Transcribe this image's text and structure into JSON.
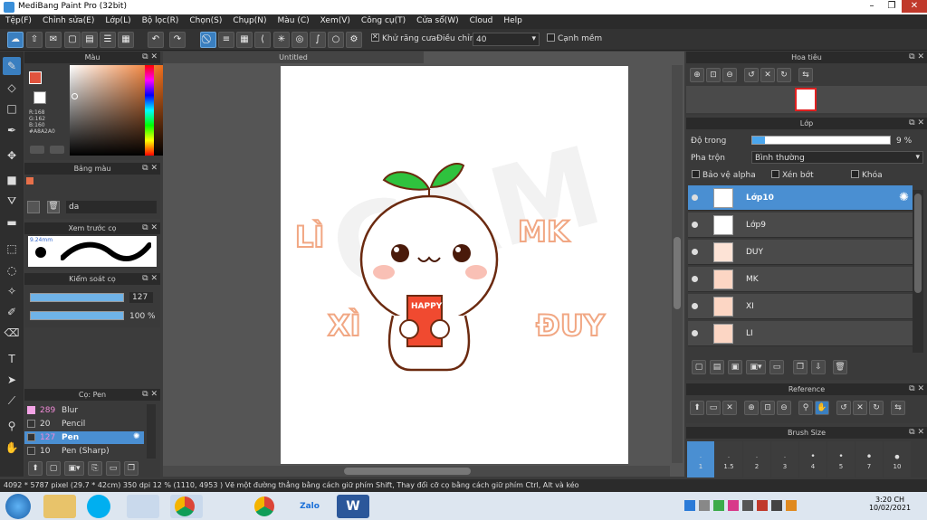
{
  "window": {
    "title": "MediBang Paint Pro (32bit)"
  },
  "menu": [
    "Tệp(F)",
    "Chỉnh sửa(E)",
    "Lớp(L)",
    "Bộ lọc(R)",
    "Chọn(S)",
    "Chụp(N)",
    "Màu (C)",
    "Xem(V)",
    "Công cụ(T)",
    "Cửa sổ(W)",
    "Cloud",
    "Help"
  ],
  "toolbar": {
    "antialias_label": "Khử răng cưa",
    "adjust_label": "Điều chỉnh",
    "adjust_value": "40",
    "smooth_label": "Cạnh mềm"
  },
  "color_panel": {
    "title": "Màu",
    "r": "R:168",
    "g": "G:162",
    "b": "B:160",
    "hex": "#A8A2A0",
    "accent": "#e0533d"
  },
  "palette_panel": {
    "title": "Bảng màu",
    "entry": "da"
  },
  "brush_preview": {
    "title": "Xem trước cọ",
    "size": "9.24mm"
  },
  "control_panel": {
    "title": "Kiểm soát cọ",
    "size": "127",
    "opacity": "100 %"
  },
  "brush_panel": {
    "title": "Cọ: Pen",
    "items": [
      {
        "num": "289",
        "name": "Blur"
      },
      {
        "num": "20",
        "name": "Pencil"
      },
      {
        "num": "127",
        "name": "Pen"
      },
      {
        "num": "10",
        "name": "Pen (Sharp)"
      }
    ]
  },
  "canvas": {
    "tab": "Untitled",
    "texts": {
      "li": "LÌ",
      "mk": "MK",
      "xi": "XÌ",
      "duy": "ĐUY",
      "watermark": "CAM",
      "box": "HAPPY"
    }
  },
  "navigator": {
    "title": "Hoa tiêu"
  },
  "layer_panel": {
    "title": "Lớp",
    "opacity_label": "Độ trong",
    "opacity_value": "9 %",
    "opacity": 0.09,
    "blend_label": "Pha trộn",
    "blend_value": "Bình thường",
    "protect_alpha": "Bảo vệ alpha",
    "clipping": "Xén bớt",
    "lock": "Khóa",
    "layers": [
      "Lớp10",
      "Lớp9",
      "DUY",
      "MK",
      "XI",
      "LI"
    ]
  },
  "reference": {
    "title": "Reference"
  },
  "brush_size": {
    "title": "Brush Size",
    "sizes": [
      "1",
      "1.5",
      "2",
      "3",
      "4",
      "5",
      "7",
      "10"
    ]
  },
  "status": {
    "text": "4092 * 5787 pixel   (29.7 * 42cm)   350 dpi   12 %   (1110, 4953 )   Vẽ một đường thẳng bằng cách giữ phím Shift, Thay đổi cỡ cọ bằng cách giữ phím Ctrl, Alt và kéo"
  },
  "taskbar": {
    "time": "3:20 CH",
    "date": "10/02/2021",
    "zalo": "Zalo"
  }
}
